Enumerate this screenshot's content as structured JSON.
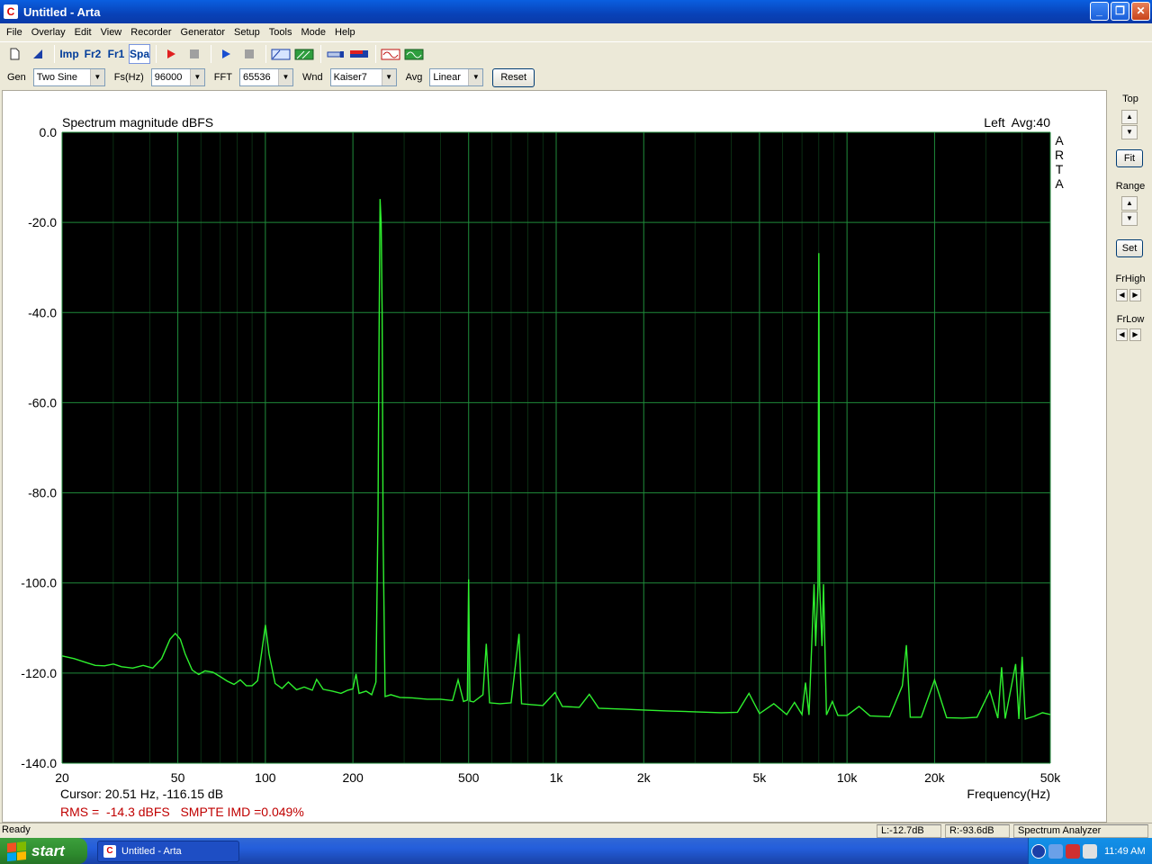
{
  "window": {
    "title": "Untitled - Arta",
    "app_icon": "C",
    "buttons": {
      "minimize": "_",
      "maximize": "❐",
      "close": "✕"
    }
  },
  "menu": [
    "File",
    "Overlay",
    "Edit",
    "View",
    "Recorder",
    "Generator",
    "Setup",
    "Tools",
    "Mode",
    "Help"
  ],
  "toolbar": {
    "imp": "Imp",
    "fr2": "Fr2",
    "fr1": "Fr1",
    "spa": "Spa"
  },
  "controls": {
    "gen_label": "Gen",
    "gen_value": "Two Sine",
    "fs_label": "Fs(Hz)",
    "fs_value": "96000",
    "fft_label": "FFT",
    "fft_value": "65536",
    "wnd_label": "Wnd",
    "wnd_value": "Kaiser7",
    "avg_label": "Avg",
    "avg_value": "Linear",
    "reset_label": "Reset"
  },
  "right_panel": {
    "top_label": "Top",
    "fit_label": "Fit",
    "range_label": "Range",
    "set_label": "Set",
    "frhigh_label": "FrHigh",
    "frlow_label": "FrLow"
  },
  "chart_data": {
    "type": "line",
    "title": "Spectrum magnitude dBFS",
    "channel_label": "Left  Avg:40",
    "watermark": "ARTA",
    "xlabel": "Frequency(Hz)",
    "ylabel": "",
    "xscale": "log",
    "xlim": [
      20,
      50000
    ],
    "ylim": [
      -140,
      0
    ],
    "y_ticks": [
      "0.0",
      "-20.0",
      "-40.0",
      "-60.0",
      "-80.0",
      "-100.0",
      "-120.0",
      "-140.0"
    ],
    "x_ticks": [
      {
        "v": 20,
        "label": "20"
      },
      {
        "v": 50,
        "label": "50"
      },
      {
        "v": 100,
        "label": "100"
      },
      {
        "v": 200,
        "label": "200"
      },
      {
        "v": 500,
        "label": "500"
      },
      {
        "v": 1000,
        "label": "1k"
      },
      {
        "v": 2000,
        "label": "2k"
      },
      {
        "v": 5000,
        "label": "5k"
      },
      {
        "v": 10000,
        "label": "10k"
      },
      {
        "v": 20000,
        "label": "20k"
      },
      {
        "v": 50000,
        "label": "50k"
      }
    ],
    "grid": true,
    "background": "#000000",
    "grid_color": "#1f8a3a",
    "trace_color": "#2ef02e",
    "series": [
      {
        "values": [
          [
            20,
            -116.2
          ],
          [
            22,
            -116.8
          ],
          [
            24,
            -117.6
          ],
          [
            26,
            -118.3
          ],
          [
            28,
            -118.4
          ],
          [
            30,
            -118.0
          ],
          [
            32,
            -118.6
          ],
          [
            35,
            -118.9
          ],
          [
            38,
            -118.3
          ],
          [
            41,
            -118.9
          ],
          [
            44,
            -116.8
          ],
          [
            47,
            -112.5
          ],
          [
            49,
            -111.2
          ],
          [
            51,
            -112.5
          ],
          [
            53,
            -115.8
          ],
          [
            56,
            -119.3
          ],
          [
            59,
            -120.3
          ],
          [
            62,
            -119.5
          ],
          [
            66,
            -119.8
          ],
          [
            70,
            -120.8
          ],
          [
            74,
            -121.8
          ],
          [
            78,
            -122.5
          ],
          [
            82,
            -121.5
          ],
          [
            86,
            -122.8
          ],
          [
            90,
            -122.8
          ],
          [
            94,
            -121.7
          ],
          [
            97,
            -115.6
          ],
          [
            100,
            -109.3
          ],
          [
            103,
            -115.8
          ],
          [
            108,
            -122.3
          ],
          [
            114,
            -123.4
          ],
          [
            120,
            -122.0
          ],
          [
            128,
            -123.7
          ],
          [
            136,
            -123.1
          ],
          [
            145,
            -123.8
          ],
          [
            150,
            -121.4
          ],
          [
            158,
            -123.6
          ],
          [
            170,
            -124.0
          ],
          [
            182,
            -124.5
          ],
          [
            192,
            -123.8
          ],
          [
            200,
            -123.5
          ],
          [
            205,
            -120.2
          ],
          [
            210,
            -124.5
          ],
          [
            222,
            -124.0
          ],
          [
            232,
            -124.8
          ],
          [
            240,
            -122.0
          ],
          [
            244,
            -85.0
          ],
          [
            246,
            -45.0
          ],
          [
            248,
            -14.8
          ],
          [
            250,
            -20.0
          ],
          [
            252,
            -40.0
          ],
          [
            254,
            -90.0
          ],
          [
            258,
            -125.2
          ],
          [
            270,
            -124.8
          ],
          [
            290,
            -125.4
          ],
          [
            320,
            -125.5
          ],
          [
            360,
            -125.8
          ],
          [
            400,
            -125.8
          ],
          [
            440,
            -126.1
          ],
          [
            460,
            -121.5
          ],
          [
            480,
            -126.3
          ],
          [
            495,
            -126.0
          ],
          [
            500,
            -99.2
          ],
          [
            505,
            -126.2
          ],
          [
            520,
            -126.4
          ],
          [
            560,
            -124.8
          ],
          [
            575,
            -113.5
          ],
          [
            590,
            -126.6
          ],
          [
            640,
            -126.8
          ],
          [
            700,
            -126.6
          ],
          [
            745,
            -111.3
          ],
          [
            760,
            -126.8
          ],
          [
            820,
            -127.0
          ],
          [
            900,
            -127.2
          ],
          [
            990,
            -124.3
          ],
          [
            1050,
            -127.4
          ],
          [
            1200,
            -127.6
          ],
          [
            1300,
            -124.7
          ],
          [
            1400,
            -127.8
          ],
          [
            1700,
            -128.0
          ],
          [
            2000,
            -128.2
          ],
          [
            2400,
            -128.4
          ],
          [
            3000,
            -128.6
          ],
          [
            3700,
            -128.8
          ],
          [
            4200,
            -128.7
          ],
          [
            4600,
            -124.5
          ],
          [
            5000,
            -129.0
          ],
          [
            5600,
            -126.8
          ],
          [
            6200,
            -129.2
          ],
          [
            6600,
            -126.5
          ],
          [
            7000,
            -129.2
          ],
          [
            7200,
            -122.1
          ],
          [
            7400,
            -129.3
          ],
          [
            7700,
            -100.3
          ],
          [
            7800,
            -114.0
          ],
          [
            7950,
            -100.3
          ],
          [
            8000,
            -26.8
          ],
          [
            8050,
            -100.3
          ],
          [
            8200,
            -114.0
          ],
          [
            8300,
            -100.3
          ],
          [
            8500,
            -129.3
          ],
          [
            8900,
            -126.3
          ],
          [
            9300,
            -129.4
          ],
          [
            10000,
            -129.4
          ],
          [
            11000,
            -127.4
          ],
          [
            12000,
            -129.5
          ],
          [
            14000,
            -129.7
          ],
          [
            15500,
            -122.8
          ],
          [
            16000,
            -113.8
          ],
          [
            16500,
            -129.8
          ],
          [
            18000,
            -129.8
          ],
          [
            20000,
            -121.5
          ],
          [
            22000,
            -129.9
          ],
          [
            25000,
            -130.0
          ],
          [
            28000,
            -129.8
          ],
          [
            31000,
            -123.9
          ],
          [
            33000,
            -130.0
          ],
          [
            34000,
            -118.7
          ],
          [
            35000,
            -130.1
          ],
          [
            38000,
            -118.0
          ],
          [
            39000,
            -130.2
          ],
          [
            40000,
            -116.4
          ],
          [
            41000,
            -130.2
          ],
          [
            44000,
            -129.6
          ],
          [
            47000,
            -128.8
          ],
          [
            50000,
            -129.2
          ]
        ]
      }
    ],
    "cursor_text": "Cursor: 20.51 Hz, -116.15 dB",
    "rms_text": "RMS =  -14.3 dBFS   SMPTE IMD =0.049%"
  },
  "status": {
    "left": "Ready",
    "l_level": "L:-12.7dB",
    "r_level": "R:-93.6dB",
    "mode": "Spectrum Analyzer"
  },
  "taskbar": {
    "start_label": "start",
    "task_label": "Untitled - Arta",
    "clock": "11:49 AM"
  }
}
